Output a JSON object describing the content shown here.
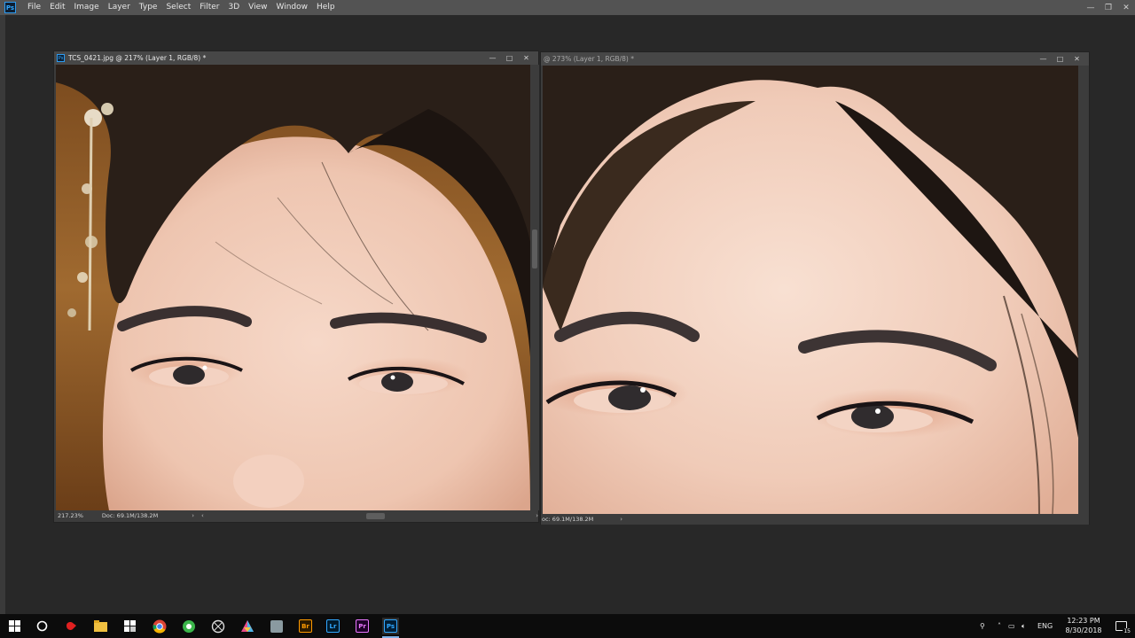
{
  "app": {
    "logo": "Ps",
    "menu": [
      "File",
      "Edit",
      "Image",
      "Layer",
      "Type",
      "Select",
      "Filter",
      "3D",
      "View",
      "Window",
      "Help"
    ]
  },
  "window_controls": {
    "minimize": "—",
    "restore": "❐",
    "close": "✕"
  },
  "documents": [
    {
      "title": "TCS_0421.jpg @ 217% (Layer 1, RGB/8) *",
      "zoom": "217.23%",
      "doc_size": "Doc: 69.1M/138.2M"
    },
    {
      "title": "@ 273% (Layer 1, RGB/8) *",
      "doc_size": "oc: 69.1M/138.2M"
    }
  ],
  "doc_controls": {
    "minimize": "—",
    "restore": "□",
    "close": "✕"
  },
  "taskbar": {
    "apps": [
      {
        "name": "Bridge",
        "label": "Br",
        "color": "#ff9a00"
      },
      {
        "name": "Lightroom",
        "label": "Lr",
        "color": "#31a8ff"
      },
      {
        "name": "Premiere",
        "label": "Pr",
        "color": "#ea77ff"
      },
      {
        "name": "Photoshop",
        "label": "Ps",
        "color": "#31a8ff"
      }
    ],
    "language": "ENG",
    "time": "12:23 PM",
    "date": "8/30/2018",
    "notifications": "15"
  },
  "colors": {
    "menubar": "#535353",
    "workspace": "#282828",
    "taskbar": "#0c0c0c",
    "photoshop_blue": "#31a8ff"
  }
}
